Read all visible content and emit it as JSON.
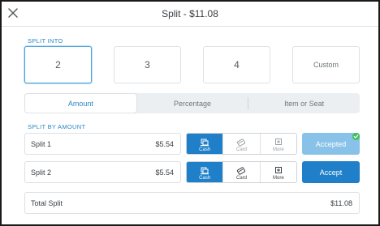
{
  "header": {
    "title": "Split - $11.08"
  },
  "split_into": {
    "label": "SPLIT INTO",
    "options": [
      "2",
      "3",
      "4",
      "Custom"
    ],
    "selected": "2"
  },
  "mode_tabs": {
    "items": [
      "Amount",
      "Percentage",
      "Item or Seat"
    ],
    "active": "Amount"
  },
  "split_by_amount": {
    "label": "SPLIT BY AMOUNT",
    "rows": [
      {
        "name": "Split 1",
        "amount": "$5.54",
        "payment": [
          "Cash",
          "Card",
          "More"
        ],
        "selected_payment": "Cash",
        "action": "Accepted",
        "accepted": true
      },
      {
        "name": "Split 2",
        "amount": "$5.54",
        "payment": [
          "Cash",
          "Card",
          "More"
        ],
        "selected_payment": "Cash",
        "action": "Accept",
        "accepted": false
      }
    ]
  },
  "total": {
    "label": "Total Split",
    "amount": "$11.08"
  },
  "colors": {
    "accent": "#1f7fc8",
    "accent_light": "#89c2e8",
    "label_blue": "#2b86c4",
    "success": "#3fbf5a"
  },
  "icons": {
    "close": "close-icon",
    "cash": "cash-icon",
    "card": "card-icon",
    "more": "plus-box-icon",
    "check": "check-icon"
  }
}
